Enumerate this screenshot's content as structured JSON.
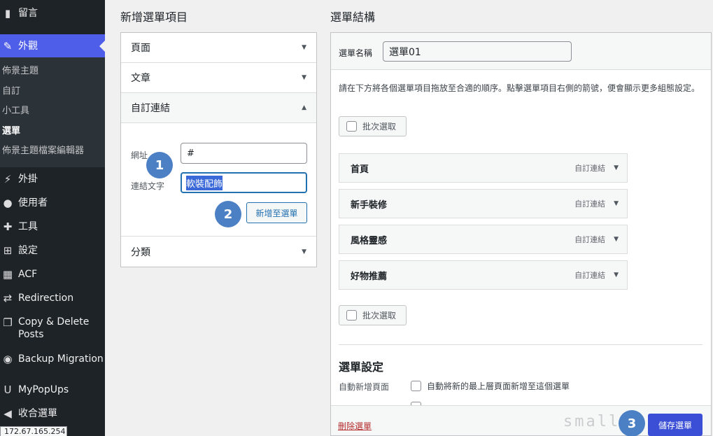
{
  "sidebar": {
    "items": [
      {
        "icon": "comment-icon",
        "glyph": "▮",
        "label": "留言"
      },
      {
        "icon": "brush-icon",
        "glyph": "✎",
        "label": "外觀"
      },
      {
        "icon": "plugin-icon",
        "glyph": "⚡",
        "label": "外掛"
      },
      {
        "icon": "user-icon",
        "glyph": "●",
        "label": "使用者"
      },
      {
        "icon": "wrench-icon",
        "glyph": "✚",
        "label": "工具"
      },
      {
        "icon": "settings-icon",
        "glyph": "⊞",
        "label": "設定"
      },
      {
        "icon": "acf-icon",
        "glyph": "▦",
        "label": "ACF"
      },
      {
        "icon": "redirection-icon",
        "glyph": "⇄",
        "label": "Redirection"
      },
      {
        "icon": "copy-icon",
        "glyph": "❐",
        "label": "Copy & Delete Posts"
      },
      {
        "icon": "backup-icon",
        "glyph": "◉",
        "label": "Backup Migration"
      },
      {
        "icon": "popup-icon",
        "glyph": "U",
        "label": "MyPopUps"
      },
      {
        "icon": "collapse-icon",
        "glyph": "◀",
        "label": "收合選單"
      }
    ],
    "submenu": [
      "佈景主題",
      "自訂",
      "小工具",
      "選單",
      "佈景主題檔案編輯器"
    ],
    "current_submenu": "選單",
    "ip_tooltip": "172.67.165.254"
  },
  "left": {
    "title": "新增選單項目",
    "sections": [
      "頁面",
      "文章",
      "自訂連結",
      "分類"
    ],
    "custom_link": {
      "url_label": "網址",
      "url_value": "#",
      "text_label": "連結文字",
      "text_value": "軟裝配飾",
      "add_button": "新增至選單"
    }
  },
  "right": {
    "title": "選單結構",
    "name_label": "選單名稱",
    "name_value": "選單01",
    "instructions": "請在下方將各個選單項目拖放至合適的順序。點擊選單項目右側的箭號，便會顯示更多組態設定。",
    "bulk_select": "批次選取",
    "items": [
      {
        "label": "首頁",
        "type": "自訂連結"
      },
      {
        "label": "新手裝修",
        "type": "自訂連結"
      },
      {
        "label": "風格靈感",
        "type": "自訂連結"
      },
      {
        "label": "好物推薦",
        "type": "自訂連結"
      }
    ],
    "settings_title": "選單設定",
    "auto_add_label": "自動新增頁面",
    "auto_add_option": "自動將新的最上層頁面新增至這個選單",
    "delete_link": "刪除選單",
    "save_button": "儲存選單"
  },
  "badges": [
    "1",
    "2",
    "3"
  ],
  "watermark": "smallw",
  "colors": {
    "sidebar": "#1d2327",
    "active": "#4f5ee8",
    "badge": "#4b80c4",
    "primary": "#3a4fd6",
    "delete": "#b32d2e"
  }
}
